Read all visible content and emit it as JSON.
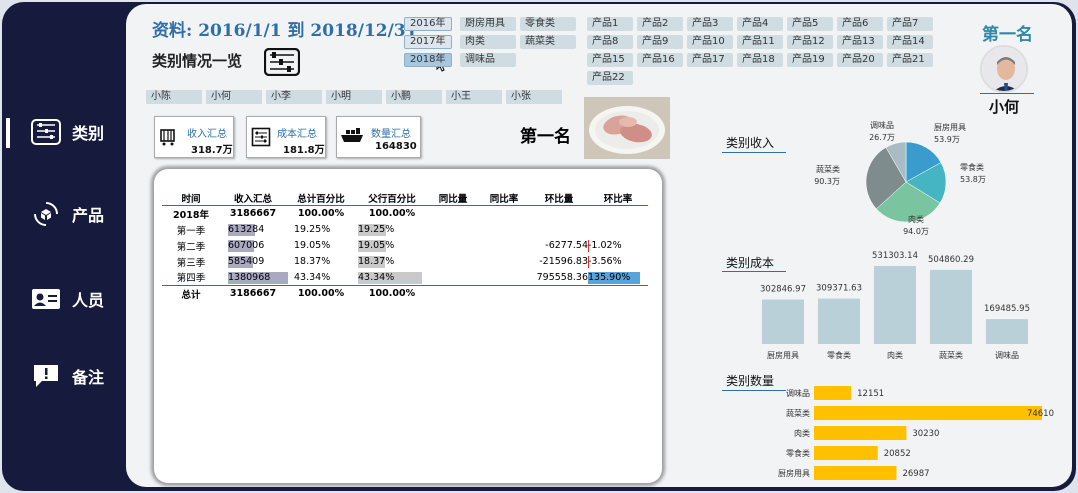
{
  "header": {
    "title": "资料: 2016/1/1 到 2018/12/31",
    "subtitle": "类别情况一览"
  },
  "sidebar": {
    "items": [
      {
        "label": "类别",
        "icon": "abacus-icon"
      },
      {
        "label": "产品",
        "icon": "box-cycle-icon"
      },
      {
        "label": "人员",
        "icon": "id-card-icon"
      },
      {
        "label": "备注",
        "icon": "comment-icon"
      }
    ]
  },
  "slicers": {
    "years": [
      "2016年",
      "2017年",
      "2018年"
    ],
    "selected_year": "2018年",
    "categories": [
      "厨房用具",
      "零食类",
      "肉类",
      "蔬菜类",
      "调味品"
    ],
    "products": [
      "产品1",
      "产品2",
      "产品3",
      "产品4",
      "产品5",
      "产品6",
      "产品7",
      "产品8",
      "产品9",
      "产品10",
      "产品11",
      "产品12",
      "产品13",
      "产品14",
      "产品15",
      "产品16",
      "产品17",
      "产品18",
      "产品19",
      "产品20",
      "产品21",
      "产品22"
    ],
    "people": [
      "小陈",
      "小何",
      "小李",
      "小明",
      "小鹏",
      "小王",
      "小张"
    ]
  },
  "kpis": [
    {
      "label": "收入汇总",
      "value": "318.7万",
      "icon": "shopping-cart-icon"
    },
    {
      "label": "成本汇总",
      "value": "181.8万",
      "icon": "abacus-icon"
    },
    {
      "label": "数量汇总",
      "value": "164830",
      "icon": "cargo-ship-icon"
    }
  ],
  "top_product": {
    "label": "第一名",
    "image": "meat-plate-photo"
  },
  "top_person": {
    "label": "第一名",
    "name": "小何",
    "image": "person-avatar"
  },
  "table": {
    "headers": [
      "时间",
      "收入汇总",
      "总计百分比",
      "父行百分比",
      "同比量",
      "同比率",
      "环比量",
      "环比率"
    ],
    "rows": [
      {
        "time": "2018年",
        "income": "3186667",
        "total_pct": "100.00%",
        "parent_pct": "100.00%",
        "yoy": "",
        "yoy_rate": "",
        "mom": "",
        "mom_rate": "",
        "income_frac": 0,
        "parent_frac": 0,
        "mom_frac": 0,
        "bold": true
      },
      {
        "time": "第一季",
        "income": "613284",
        "total_pct": "19.25%",
        "parent_pct": "19.25%",
        "yoy": "",
        "yoy_rate": "",
        "mom": "",
        "mom_rate": "",
        "income_frac": 0.444,
        "parent_frac": 0.444,
        "mom_frac": 0
      },
      {
        "time": "第二季",
        "income": "607006",
        "total_pct": "19.05%",
        "parent_pct": "19.05%",
        "yoy": "",
        "yoy_rate": "",
        "mom": "-6277.54",
        "mom_rate": "-1.02%",
        "income_frac": 0.44,
        "parent_frac": 0.44,
        "mom_frac": -0.01
      },
      {
        "time": "第三季",
        "income": "585409",
        "total_pct": "18.37%",
        "parent_pct": "18.37%",
        "yoy": "",
        "yoy_rate": "",
        "mom": "-21596.83",
        "mom_rate": "-3.56%",
        "income_frac": 0.424,
        "parent_frac": 0.424,
        "mom_frac": -0.03
      },
      {
        "time": "第四季",
        "income": "1380968",
        "total_pct": "43.34%",
        "parent_pct": "43.34%",
        "yoy": "",
        "yoy_rate": "",
        "mom": "795558.36",
        "mom_rate": "135.90%",
        "income_frac": 1,
        "parent_frac": 1,
        "mom_frac": 1
      }
    ],
    "total": {
      "time": "总计",
      "income": "3186667",
      "total_pct": "100.00%",
      "parent_pct": "100.00%"
    }
  },
  "colors": {
    "sidebar_bg": "#161a3c",
    "accent_blue": "#2e6fa8",
    "data_bar": "#a9a9c0",
    "parent_bar": "#c9c9c9",
    "mom_positive": "#5aa3d8",
    "mom_negative": "#e03030",
    "cost_bar": "#b9d0d8",
    "qty_bar": "#ffc000"
  },
  "charts": {
    "income_title": "类别收入",
    "cost_title": "类别成本",
    "qty_title": "类别数量"
  },
  "chart_data": [
    {
      "type": "pie",
      "title": "类别收入",
      "categories": [
        "厨房用具",
        "零食类",
        "肉类",
        "蔬菜类",
        "调味品"
      ],
      "values": [
        53.9,
        53.8,
        94.0,
        90.3,
        26.7
      ],
      "labels": [
        "53.9万",
        "53.8万",
        "94.0万",
        "90.3万",
        "26.7万"
      ],
      "colors": [
        "#3a9ccc",
        "#45b5c4",
        "#7ac5a0",
        "#7f8c8d",
        "#a9bcc4"
      ]
    },
    {
      "type": "bar",
      "title": "类别成本",
      "categories": [
        "厨房用具",
        "零食类",
        "肉类",
        "蔬菜类",
        "调味品"
      ],
      "values": [
        302846.97,
        309371.63,
        531303.14,
        504860.29,
        169485.95
      ],
      "labels": [
        "302846.97",
        "309371.63",
        "531303.14",
        "504860.29",
        "169485.95"
      ]
    },
    {
      "type": "bar",
      "orientation": "horizontal",
      "title": "类别数量",
      "categories": [
        "调味品",
        "蔬菜类",
        "肉类",
        "零食类",
        "厨房用具"
      ],
      "values": [
        12151,
        74610,
        30230,
        20852,
        26987
      ]
    }
  ]
}
